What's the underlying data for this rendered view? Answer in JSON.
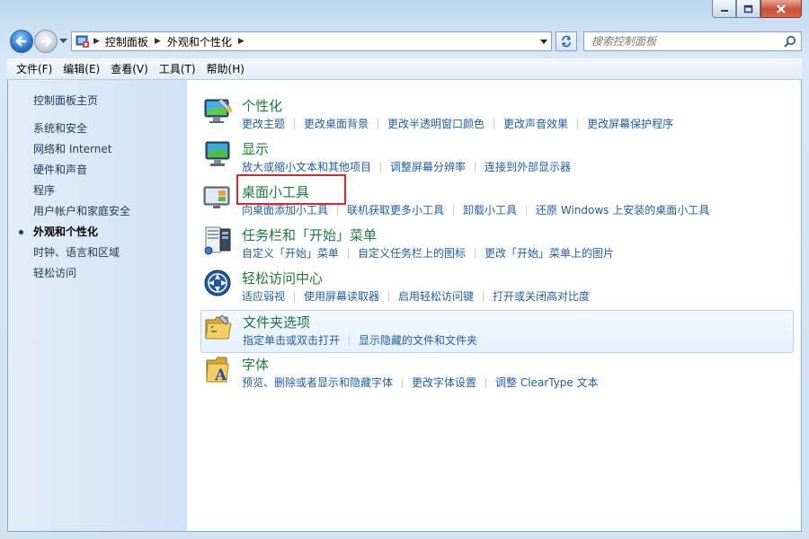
{
  "address": {
    "crumbs": [
      "控制面板",
      "外观和个性化"
    ]
  },
  "search": {
    "placeholder": "搜索控制面板"
  },
  "menu": [
    "文件(F)",
    "编辑(E)",
    "查看(V)",
    "工具(T)",
    "帮助(H)"
  ],
  "sidebar": {
    "home": "控制面板主页",
    "items": [
      "系统和安全",
      "网络和 Internet",
      "硬件和声音",
      "程序",
      "用户帐户和家庭安全",
      "外观和个性化",
      "时钟、语言和区域",
      "轻松访问"
    ],
    "current_index": 5
  },
  "categories": [
    {
      "icon": "personalization-icon",
      "title": "个性化",
      "links": [
        "更改主题",
        "更改桌面背景",
        "更改半透明窗口颜色",
        "更改声音效果",
        "更改屏幕保护程序"
      ]
    },
    {
      "icon": "display-icon",
      "title": "显示",
      "links": [
        "放大或缩小文本和其他项目",
        "调整屏幕分辨率",
        "连接到外部显示器"
      ]
    },
    {
      "icon": "gadgets-icon",
      "title": "桌面小工具",
      "links": [
        "向桌面添加小工具",
        "联机获取更多小工具",
        "卸载小工具",
        "还原 Windows 上安装的桌面小工具"
      ]
    },
    {
      "icon": "taskbar-icon",
      "title": "任务栏和「开始」菜单",
      "links": [
        "自定义「开始」菜单",
        "自定义任务栏上的图标",
        "更改「开始」菜单上的图片"
      ]
    },
    {
      "icon": "ease-of-access-icon",
      "title": "轻松访问中心",
      "links": [
        "适应弱视",
        "使用屏幕读取器",
        "启用轻松访问键",
        "打开或关闭高对比度"
      ]
    },
    {
      "icon": "folder-options-icon",
      "title": "文件夹选项",
      "links": [
        "指定单击或双击打开",
        "显示隐藏的文件和文件夹"
      ]
    },
    {
      "icon": "fonts-icon",
      "title": "字体",
      "links": [
        "预览、删除或者显示和隐藏字体",
        "更改字体设置",
        "调整 ClearType 文本"
      ]
    }
  ],
  "highlighted_category_index": 2,
  "hover_category_index": 5,
  "colors": {
    "category_title": "#1b7a3f",
    "link": "#1f5ea8",
    "highlight_box": "#e0252a"
  }
}
